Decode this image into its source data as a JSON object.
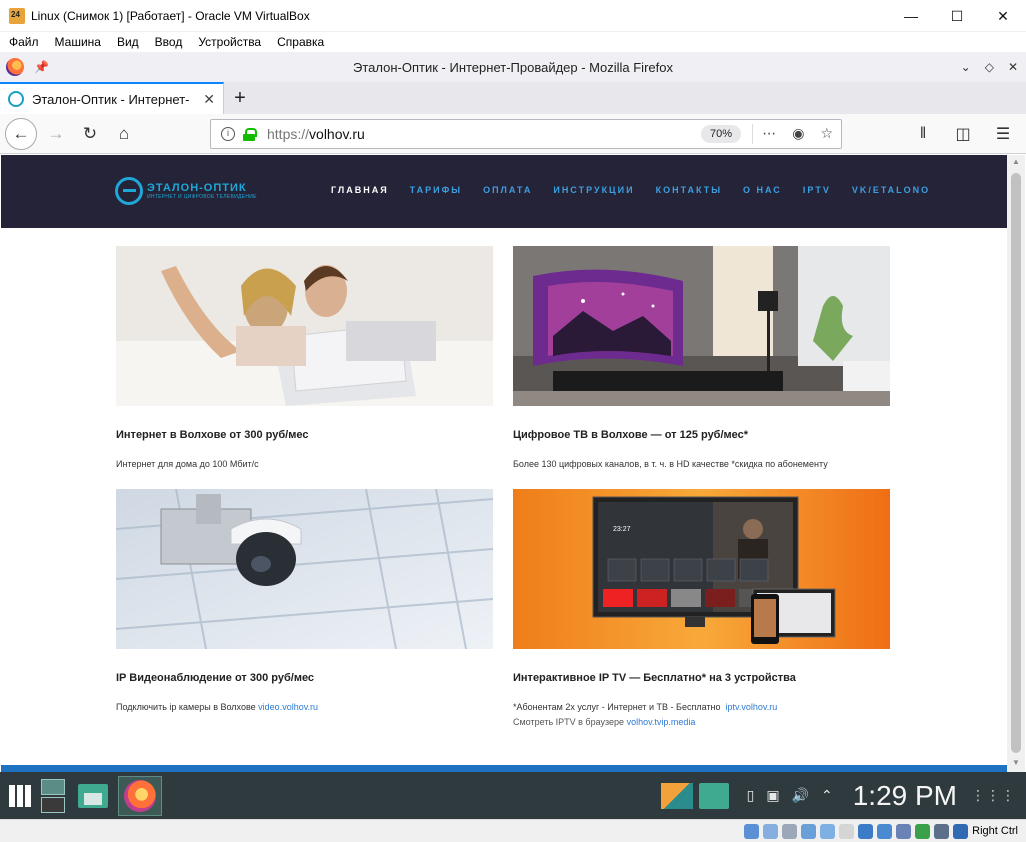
{
  "vbox": {
    "title": "Linux (Снимок 1) [Работает] - Oracle VM VirtualBox",
    "menu": [
      "Файл",
      "Машина",
      "Вид",
      "Ввод",
      "Устройства",
      "Справка"
    ],
    "host_key": "Right Ctrl"
  },
  "firefox": {
    "window_title": "Эталон-Оптик - Интернет-Провайдер - Mozilla Firefox",
    "tab_label": "Эталон-Оптик - Интернет-",
    "url_proto": "https://",
    "url_host": "volhov.ru",
    "zoom": "70%"
  },
  "site": {
    "logo_name": "ЭТАЛОН-ОПТИК",
    "logo_sub": "ИНТЕРНЕТ И ЦИФРОВОЕ ТЕЛЕВИДЕНИЕ",
    "nav": [
      "ГЛАВНАЯ",
      "ТАРИФЫ",
      "ОПЛАТА",
      "ИНСТРУКЦИИ",
      "КОНТАКТЫ",
      "О НАС",
      "IPTV",
      "VK/ETALONO"
    ],
    "cards": [
      {
        "title": "Интернет в Волхове от 300 руб/мес",
        "desc": "Интернет для дома до 100 Мбит/с"
      },
      {
        "title": "Цифровое ТВ в Волхове — от 125 руб/мес*",
        "desc": "Более 130 цифровых каналов, в т. ч. в HD качестве *скидка по абонементу"
      },
      {
        "title": "IP Видеонаблюдение от 300 руб/мес",
        "desc": "Подключить ip камеры в Волхове",
        "link": "video.volhov.ru"
      },
      {
        "title": "Интерактивное IP TV — Бесплатно* на 3 устройства",
        "desc": "*Абонентам 2х услуг - Интернет и ТВ - Бесплатно",
        "link": "iptv.volhov.ru",
        "desc2": "Смотреть IPTV в браузере",
        "link2": "volhov.tvip.media"
      }
    ],
    "tv_time": "23:27"
  },
  "taskbar": {
    "clock": "1:29 PM"
  }
}
